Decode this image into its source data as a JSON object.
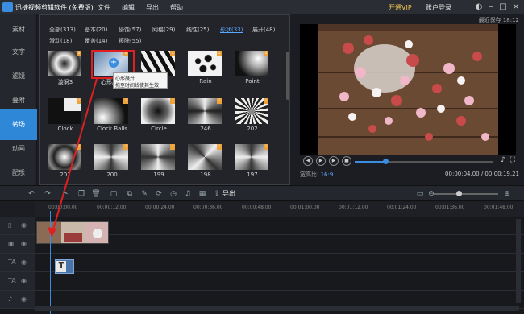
{
  "app": {
    "title": "迅捷视频剪辑软件 (免费版)"
  },
  "menu": [
    "文件",
    "编辑",
    "导出",
    "帮助"
  ],
  "header": {
    "vip": "开通VIP",
    "account": "账户登录"
  },
  "sidebar": {
    "items": [
      {
        "label": "素材",
        "active": false
      },
      {
        "label": "文字",
        "active": false
      },
      {
        "label": "滤镜",
        "active": false
      },
      {
        "label": "叠附",
        "active": false
      },
      {
        "label": "转场",
        "active": true
      },
      {
        "label": "动画",
        "active": false
      },
      {
        "label": "配乐",
        "active": false
      }
    ]
  },
  "tabs": [
    {
      "label": "全部(313)",
      "active": false
    },
    {
      "label": "基本(20)",
      "active": false
    },
    {
      "label": "侵蚀(57)",
      "active": false
    },
    {
      "label": "网格(29)",
      "active": false
    },
    {
      "label": "线性(25)",
      "active": false
    },
    {
      "label": "形状(33)",
      "active": true
    },
    {
      "label": "展开(48)",
      "active": false
    },
    {
      "label": "滑动(18)",
      "active": false
    },
    {
      "label": "覆盖(14)",
      "active": false
    },
    {
      "label": "擦除(55)",
      "active": false
    }
  ],
  "transitions": [
    "漩涡3",
    "心形展开",
    "",
    "Rain",
    "Point",
    "Clock",
    "Clock Balls",
    "Circle",
    "246",
    "202",
    "201",
    "200",
    "199",
    "198",
    "197"
  ],
  "tooltip": {
    "title": "心形展开",
    "hint": "拖至时间线使其生效"
  },
  "preview": {
    "autosave": "最近保存 18:12",
    "ratio_label": "宽高比:",
    "ratio_value": "16:9",
    "time": "00:00:04.00 / 00:00:19.21",
    "progress": 0.22
  },
  "toolbar": {
    "export_label": "导出"
  },
  "ruler": [
    "00:00:00.00",
    "00:00:12.00",
    "00:00:24.00",
    "00:00:36.00",
    "00:00:48.00",
    "00:01:00.00",
    "00:01:12.00",
    "00:01:24.00",
    "00:01:36.00",
    "00:01:48.00"
  ],
  "textclip": {
    "glyph": "T"
  },
  "colors": {
    "accent": "#2f87d8",
    "highlight": "#e02020",
    "vip": "#f1c453"
  }
}
